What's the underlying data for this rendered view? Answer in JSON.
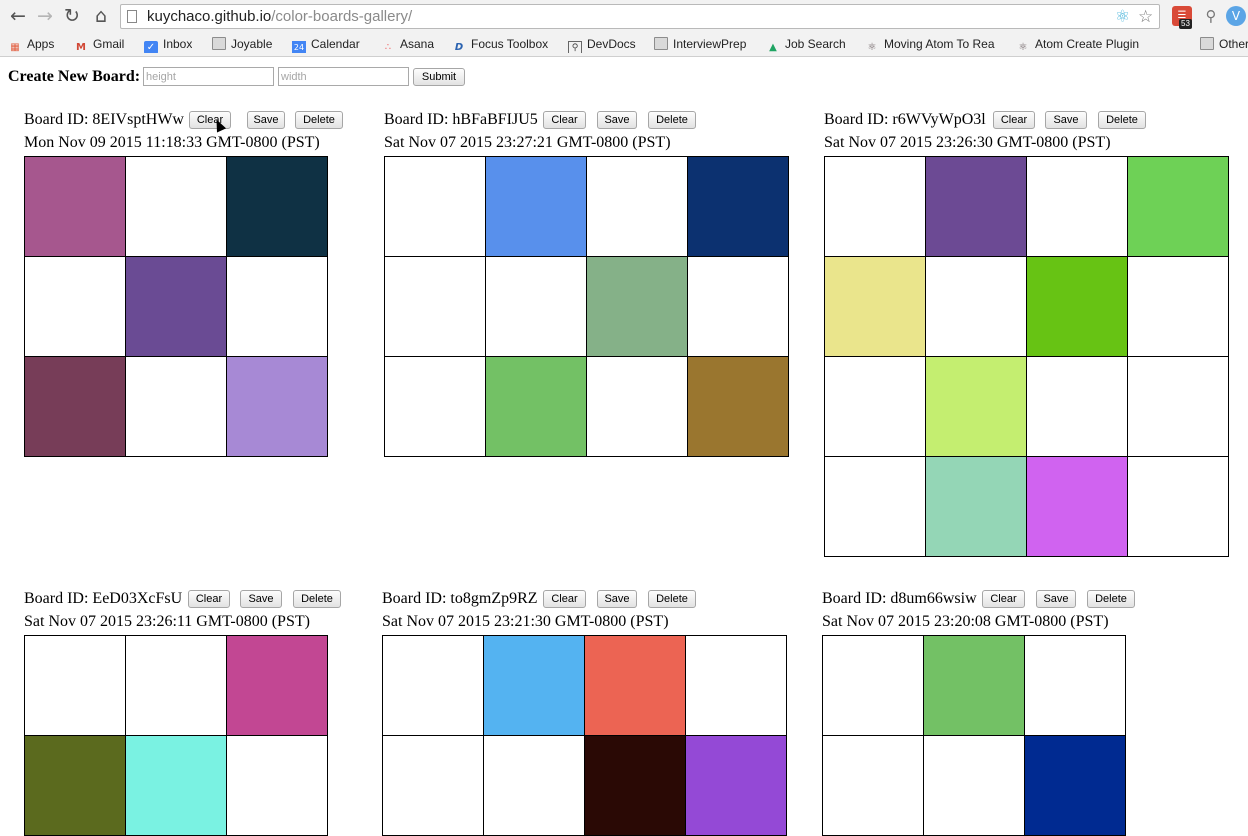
{
  "browser": {
    "url_host": "kuychaco.github.io",
    "url_path": "/color-boards-gallery/",
    "badge_count": "53"
  },
  "bookmarks": [
    {
      "label": "Apps",
      "icon": "apps-grid-icon"
    },
    {
      "label": "Gmail",
      "icon": "gmail-icon"
    },
    {
      "label": "Inbox",
      "icon": "inbox-icon"
    },
    {
      "label": "Joyable",
      "icon": "folder-icon"
    },
    {
      "label": "Calendar",
      "icon": "calendar-icon",
      "icon_text": "24"
    },
    {
      "label": "Asana",
      "icon": "asana-icon"
    },
    {
      "label": "Focus Toolbox",
      "icon": "focus-icon"
    },
    {
      "label": "DevDocs",
      "icon": "devdocs-icon"
    },
    {
      "label": "InterviewPrep",
      "icon": "folder-icon"
    },
    {
      "label": "Job Search",
      "icon": "drive-icon"
    },
    {
      "label": "Moving Atom To Rea",
      "icon": "atom-icon"
    },
    {
      "label": "Atom Create Plugin",
      "icon": "atom-icon"
    },
    {
      "label": "Other",
      "icon": "folder-icon"
    }
  ],
  "create": {
    "label": "Create New Board:",
    "height_placeholder": "height",
    "width_placeholder": "width",
    "submit_label": "Submit"
  },
  "buttons": {
    "clear": "Clear",
    "save": "Save",
    "delete": "Delete"
  },
  "boards": [
    {
      "id_text": "Board ID: 8EIVsptHWw",
      "date": "Mon Nov 09 2015 11:18:33 GMT-0800 (PST)",
      "cols": 3,
      "cells": [
        "#a6578e",
        "#ffffff",
        "#0f3144",
        "#ffffff",
        "#6a4b94",
        "#ffffff",
        "#773d58",
        "#ffffff",
        "#a789d5"
      ]
    },
    {
      "id_text": "Board ID: hBFaBFIJU5",
      "date": "Sat Nov 07 2015 23:27:21 GMT-0800 (PST)",
      "cols": 4,
      "cells": [
        "#ffffff",
        "#5890ec",
        "#ffffff",
        "#0c3170",
        "#ffffff",
        "#ffffff",
        "#85b188",
        "#ffffff",
        "#ffffff",
        "#73c165",
        "#ffffff",
        "#9a762f"
      ]
    },
    {
      "id_text": "Board ID: r6WVyWpO3l",
      "date": "Sat Nov 07 2015 23:26:30 GMT-0800 (PST)",
      "cols": 4,
      "cells": [
        "#ffffff",
        "#6c4a94",
        "#ffffff",
        "#6ed156",
        "#eae58c",
        "#ffffff",
        "#67c314",
        "#ffffff",
        "#ffffff",
        "#c4ee70",
        "#ffffff",
        "#ffffff",
        "#ffffff",
        "#94d6b6",
        "#d063f0",
        "#ffffff"
      ]
    },
    {
      "id_text": "Board ID: EeD03XcFsU",
      "date": "Sat Nov 07 2015 23:26:11 GMT-0800 (PST)",
      "cols": 3,
      "cells": [
        "#ffffff",
        "#ffffff",
        "#c24793",
        "#5b6a1e",
        "#7af2e2",
        "#ffffff"
      ]
    },
    {
      "id_text": "Board ID: to8gmZp9RZ",
      "date": "Sat Nov 07 2015 23:21:30 GMT-0800 (PST)",
      "cols": 4,
      "cells": [
        "#ffffff",
        "#54b3f1",
        "#ec6453",
        "#ffffff",
        "#ffffff",
        "#ffffff",
        "#2a0905",
        "#9449d6"
      ]
    },
    {
      "id_text": "Board ID: d8um66wsiw",
      "date": "Sat Nov 07 2015 23:20:08 GMT-0800 (PST)",
      "cols": 3,
      "cells": [
        "#ffffff",
        "#73c165",
        "#ffffff",
        "#ffffff",
        "#ffffff",
        "#002a91"
      ]
    }
  ]
}
